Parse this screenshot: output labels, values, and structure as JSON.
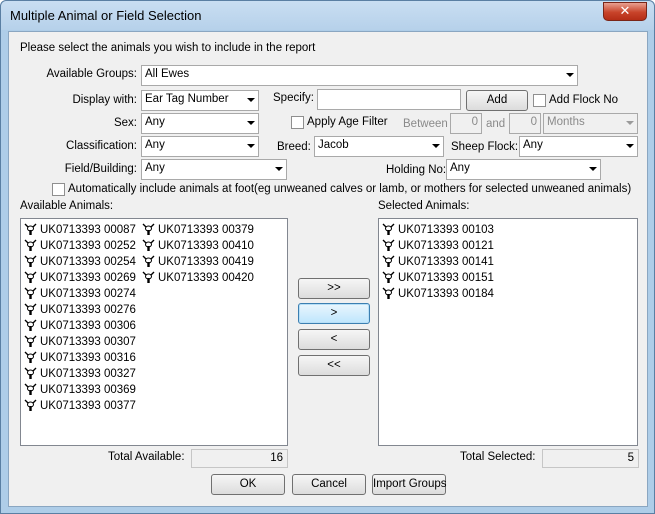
{
  "window": {
    "title": "Multiple Animal or Field Selection",
    "close_glyph": "✕"
  },
  "instruction": "Please select the animals you wish to include in the report",
  "available_groups": {
    "label": "Available Groups:",
    "value": "All Ewes"
  },
  "display_with": {
    "label": "Display with:",
    "value": "Ear Tag Number"
  },
  "specify": {
    "label": "Specify:",
    "value": ""
  },
  "add_button": "Add",
  "add_flock_no": "Add Flock No",
  "sex": {
    "label": "Sex:",
    "value": "Any"
  },
  "apply_age_filter": "Apply Age Filter",
  "between": {
    "label": "Between",
    "from": "0",
    "and_label": "and",
    "to": "0",
    "unit": "Months"
  },
  "classification": {
    "label": "Classification:",
    "value": "Any"
  },
  "breed": {
    "label": "Breed:",
    "value": "Jacob"
  },
  "sheep_flock": {
    "label": "Sheep Flock:",
    "value": "Any"
  },
  "field_building": {
    "label": "Field/Building:",
    "value": "Any"
  },
  "holding_no": {
    "label": "Holding No:",
    "value": "Any"
  },
  "auto_include": "Automatically include animals at foot(eg unweaned calves or lamb, or mothers for selected unweaned animals)",
  "available_animals": {
    "label": "Available Animals:",
    "column1": [
      "UK0713393 00087",
      "UK0713393 00252",
      "UK0713393 00254",
      "UK0713393 00269",
      "UK0713393 00274",
      "UK0713393 00276",
      "UK0713393 00306",
      "UK0713393 00307",
      "UK0713393 00316",
      "UK0713393 00327",
      "UK0713393 00369",
      "UK0713393 00377"
    ],
    "column2": [
      "UK0713393 00379",
      "UK0713393 00410",
      "UK0713393 00419",
      "UK0713393 00420"
    ]
  },
  "selected_animals": {
    "label": "Selected Animals:",
    "items": [
      "UK0713393 00103",
      "UK0713393 00121",
      "UK0713393 00141",
      "UK0713393 00151",
      "UK0713393 00184"
    ]
  },
  "move_buttons": {
    "add_all": ">>",
    "add_one": ">",
    "remove_one": "<",
    "remove_all": "<<"
  },
  "totals": {
    "available_label": "Total Available:",
    "available_value": "16",
    "selected_label": "Total Selected:",
    "selected_value": "5"
  },
  "footer": {
    "ok": "OK",
    "cancel": "Cancel",
    "import_groups": "Import Groups"
  }
}
